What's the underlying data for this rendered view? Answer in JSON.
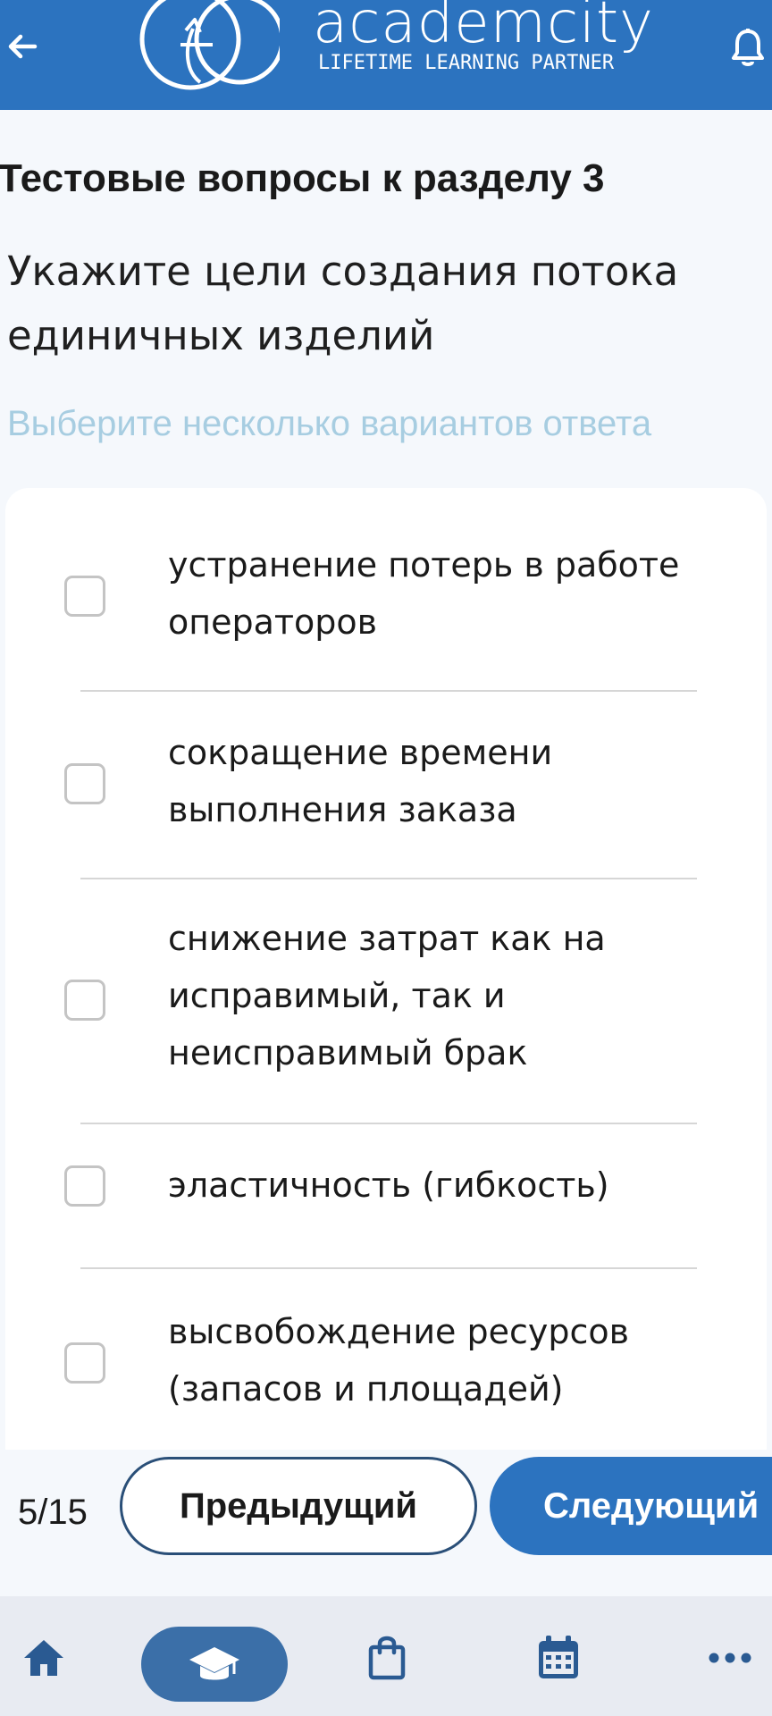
{
  "header": {
    "logo_word": "academcity",
    "logo_tagline": "LIFETIME LEARNING PARTNER",
    "back_icon": "arrow-left-icon",
    "bell_icon": "bell-icon",
    "color": "#2c73bf"
  },
  "content": {
    "section_title": "Тестовые вопросы к разделу 3",
    "question": "Укажите цели создания потока единичных изделий",
    "hint": "Выберите несколько вариантов ответа"
  },
  "options": [
    {
      "text": "устранение потерь в работе операторов",
      "checked": false
    },
    {
      "text": "сокращение времени выполнения заказа",
      "checked": false
    },
    {
      "text": "снижение затрат как на исправимый, так и неисправимый брак",
      "checked": false
    },
    {
      "text": "эластичность (гибкость)",
      "checked": false
    },
    {
      "text": "высвобождение ресурсов (запасов и площадей)",
      "checked": false
    }
  ],
  "pager": {
    "counter": "5/15",
    "prev_label": "Предыдущий",
    "next_label": "Следующий"
  },
  "bottom_nav": {
    "items": [
      {
        "icon": "home-icon",
        "active": false
      },
      {
        "icon": "graduation-cap-icon",
        "active": true
      },
      {
        "icon": "shopping-bag-icon",
        "active": false
      },
      {
        "icon": "calendar-icon",
        "active": false
      },
      {
        "icon": "more-horizontal-icon",
        "active": false
      }
    ],
    "color": "#2a5a92"
  }
}
